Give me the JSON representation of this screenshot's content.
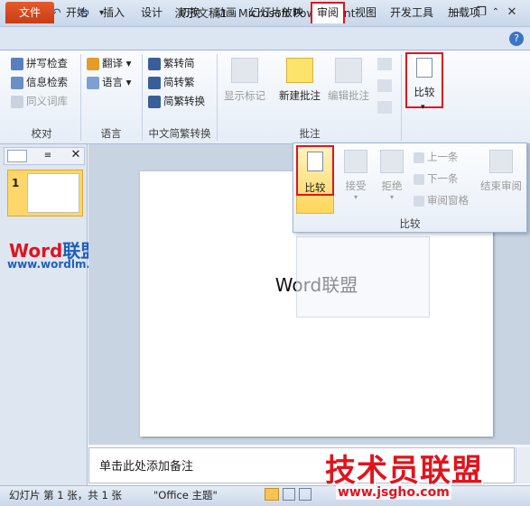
{
  "window": {
    "title": "演示文稿1 - Microsoft PowerPoint",
    "min": "—",
    "restore": "❐",
    "close": "✕"
  },
  "tabs": {
    "file": "文件",
    "home": "开始",
    "insert": "插入",
    "design": "设计",
    "transitions": "切换",
    "animations": "动画",
    "slideshow": "幻灯片放映",
    "review": "审阅",
    "view": "视图",
    "developer": "开发工具",
    "addins": "加载项"
  },
  "ribbon": {
    "proofing": {
      "label": "校对",
      "items": [
        "拼写检查",
        "信息检索",
        "同义词库"
      ]
    },
    "language": {
      "label": "语言",
      "items": [
        "翻译",
        "语言"
      ]
    },
    "chinese": {
      "label": "中文简繁转换",
      "items": [
        "繁转简",
        "简转繁",
        "简繁转换"
      ]
    },
    "comments": {
      "label": "批注",
      "show_markup": "显示标记",
      "new_comment": "新建批注",
      "edit_comment": "编辑批注"
    },
    "compare": {
      "label": "比较"
    }
  },
  "popup": {
    "compare": "比较",
    "accept": "接受",
    "reject": "拒绝",
    "prev": "上一条",
    "next": "下一条",
    "reviewing_pane": "审阅窗格",
    "end_review": "结束审阅",
    "group_label": "比较"
  },
  "slides": {
    "number": "1"
  },
  "slide": {
    "text": "Word联盟"
  },
  "notes": {
    "placeholder": "单击此处添加备注"
  },
  "status": {
    "slide_info": "幻灯片 第 1 张，共 1 张",
    "theme": "\"Office 主题\""
  },
  "watermarks": {
    "word_red": "Word",
    "word_blue": "联盟",
    "url": "www.wordlm.com",
    "big": "技术员联盟",
    "jsgho": "www.jsgho.com"
  },
  "colors": {
    "accent_red": "#e0141e",
    "file_tab": "#d0451b",
    "ribbon_bg": "#e5edf7"
  }
}
